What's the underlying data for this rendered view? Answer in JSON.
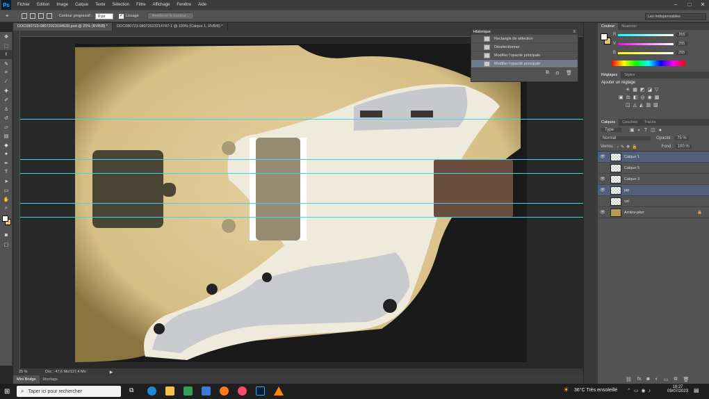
{
  "app": {
    "logo": "Ps"
  },
  "menu": [
    "Fichier",
    "Edition",
    "Image",
    "Calque",
    "Texte",
    "Sélection",
    "Filtre",
    "Affichage",
    "Fenêtre",
    "Aide"
  ],
  "options": {
    "contour_label": "Contour progressif :",
    "contour_value": "0 px",
    "lissage_label": "Lissage",
    "ameliorer_label": "Améliorer le contour...",
    "workspace": "Les indispensables"
  },
  "tabs": [
    "DOC080723-08072023194539.psd @ 25% (RVB/8) *",
    "DOC080723-08072023214747-1 @ 100% (Calque 1, RVB/8) *"
  ],
  "status": {
    "zoom": "25 %",
    "doc": "Doc : 47,6 Mo/127,4 Mo"
  },
  "bridge_tabs": [
    "Mini Bridge",
    "Montage"
  ],
  "history": {
    "title": "Historique",
    "items": [
      "Rectangle de sélection",
      "Désélectionner",
      "Modifier l'opacité principale",
      "Modifier l'opacité principale"
    ]
  },
  "color_panel": {
    "tabs": [
      "Couleur",
      "Nuancier"
    ],
    "sliders": [
      {
        "label": "R",
        "value": "255"
      },
      {
        "label": "V",
        "value": "255"
      },
      {
        "label": "B",
        "value": "255"
      }
    ]
  },
  "adjust_panel": {
    "tabs": [
      "Réglages",
      "Styles"
    ],
    "title": "Ajouter un réglage"
  },
  "layers_panel": {
    "tabs": [
      "Calques",
      "Couches",
      "Tracés"
    ],
    "filter": "Type",
    "blend": "Normal",
    "opacity_label": "Opacité :",
    "opacity": "75 %",
    "lock_label": "Verrou :",
    "fill_label": "Fond :",
    "fill": "100 %",
    "layers": [
      {
        "name": "Calque 1",
        "selected": true
      },
      {
        "name": "Calque 5",
        "selected": false
      },
      {
        "name": "Calque 3",
        "selected": false
      },
      {
        "name": "jap",
        "selected": true
      },
      {
        "name": "vst",
        "selected": false
      },
      {
        "name": "Arrière-plan",
        "selected": false
      }
    ]
  },
  "taskbar": {
    "search_placeholder": "Taper ici pour rechercher",
    "weather": "36°C  Très ensoleillé",
    "time": "18:27",
    "date": "09/07/2023"
  }
}
